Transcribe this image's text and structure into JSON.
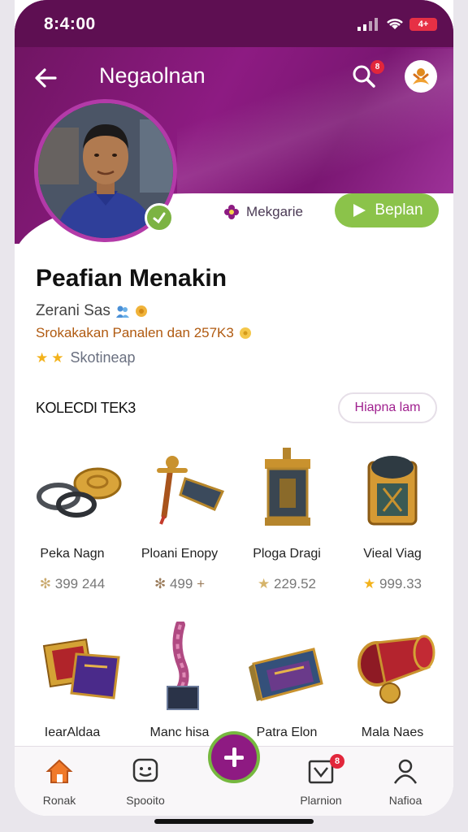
{
  "status_bar": {
    "time": "8:4:00",
    "battery": "4+"
  },
  "header": {
    "title": "Negaolnan",
    "search_badge": "8"
  },
  "profile": {
    "member_chip": "Mekgarie",
    "follow_label": "Beplan",
    "name": "Peafian Menakin",
    "subtitle": "Zerani Sas",
    "tagline": "Srokakakan Panalen dan 257K3",
    "rating_label": "Skotineap"
  },
  "collection": {
    "title": "KOLECDI TEK3",
    "see_all": "Hiapna lam",
    "items": [
      {
        "name": "Peka Nagn",
        "price": "399 244",
        "icon": "rings-icon",
        "star_color": "#c9a96e"
      },
      {
        "name": "Ploani Enopy",
        "price": "499",
        "icon": "dagger-icon",
        "star_color": "#9a7b5a"
      },
      {
        "name": "Ploga Dragi",
        "price": "229.52",
        "icon": "lantern-icon",
        "star_color": "#d6b46a"
      },
      {
        "name": "Vieal Viag",
        "price": "999.33",
        "icon": "chest-icon",
        "star_color": "#f3b21b"
      },
      {
        "name": "Ieor Aldaa",
        "name_full": "IearAldaa",
        "icon": "book-icon"
      },
      {
        "name": "Manc hisa",
        "icon": "trophy-icon"
      },
      {
        "name": "Patra Elon",
        "icon": "box-icon"
      },
      {
        "name": "Mala Naes",
        "icon": "goblet-icon"
      }
    ]
  },
  "bottom_nav": {
    "items": [
      {
        "label": "Ronak",
        "icon": "home-icon"
      },
      {
        "label": "Spooito",
        "icon": "chat-icon"
      },
      {
        "label": "Plarnion",
        "icon": "shop-icon",
        "badge": "8"
      },
      {
        "label": "Nafioa",
        "icon": "profile-icon"
      }
    ]
  },
  "colors": {
    "brand_purple": "#8d1b82",
    "accent_green": "#8bc34a",
    "badge_red": "#e2263b"
  }
}
